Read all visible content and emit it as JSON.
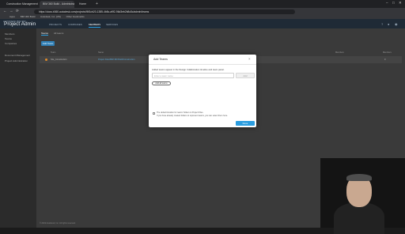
{
  "browser": {
    "tabs": [
      {
        "label": "Construction Management Cen",
        "active": false
      },
      {
        "label": "BIM 360 Build - Administration",
        "active": true
      },
      {
        "label": "Home",
        "active": false
      }
    ],
    "new_tab": "+",
    "window_controls": [
      "–",
      "□",
      "✕"
    ],
    "url": "https://docs.b360.autodesk.com/projects/f6f1cb20-1385-4b8c-a9f2-96d3eb2b8c8c/admin/teams",
    "nav": [
      "←",
      "→",
      "⟳"
    ],
    "bookmarks": [
      "Apps",
      "BIM 360 Build",
      "Autodesk, Inc. [US]",
      "Other bookmarks"
    ]
  },
  "app": {
    "brand": "AUTODESK BIM 360",
    "title": "Project Admin",
    "nav": [
      {
        "label": "PROJECTS",
        "active": false
      },
      {
        "label": "COMPANIES",
        "active": false
      },
      {
        "label": "MEMBERS",
        "active": true
      },
      {
        "label": "SERVICES",
        "active": false
      }
    ],
    "icons": [
      "help-icon",
      "notifications-icon",
      "user-icon"
    ]
  },
  "sidebar": {
    "items": [
      "Members",
      "Teams",
      "Companies",
      "Document Management",
      "Project Administration"
    ]
  },
  "main": {
    "subtabs": [
      {
        "label": "Teams",
        "active": true
      },
      {
        "label": "All teams",
        "active": false
      }
    ],
    "add_button": "Add Team",
    "columns": [
      "Team",
      "Name",
      "Members",
      "Members"
    ],
    "row": {
      "name": "Site_Construction",
      "link": "Project Files/BIM 360 Build/Construction",
      "count": "0"
    },
    "footer": "© 2022 Autodesk, Inc. All rights reserved."
  },
  "modal": {
    "title": "Add Teams",
    "close": "×",
    "description": "Added teams appear in the Design Collaboration timeline and team panel.",
    "input_placeholder": "Enter a team name",
    "add_label": "Add",
    "link_button": "Add all teams",
    "note1": "The default location for teams' folders is Project Files.",
    "note2": "If you have already created folders to represent teams, you can select them here.",
    "ok_label": "Done"
  },
  "colors": {
    "accent": "#2a9de0",
    "header": "#1f2a36",
    "overlay": "#3a3a3a"
  }
}
